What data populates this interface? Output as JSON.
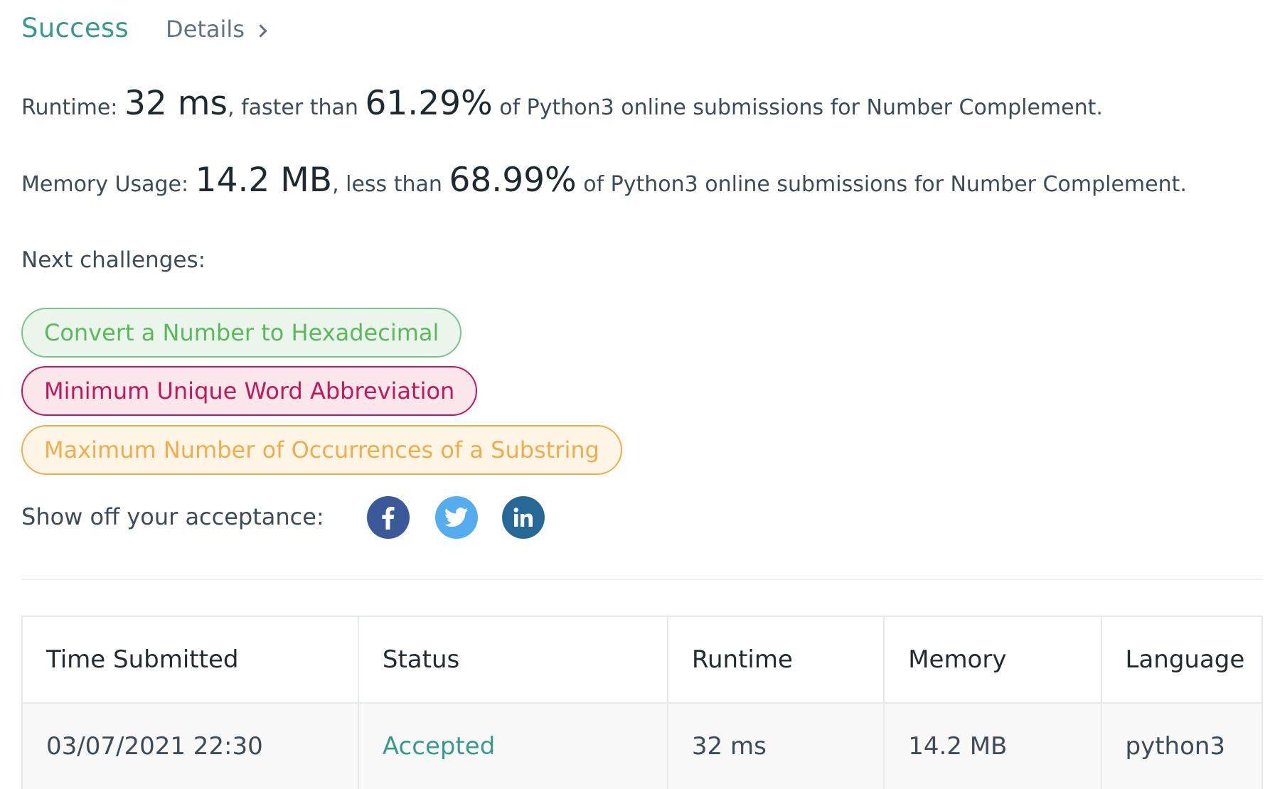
{
  "header": {
    "status": "Success",
    "details_label": "Details"
  },
  "runtime": {
    "prefix": "Runtime:",
    "value": "32 ms",
    "comparison": ", faster than",
    "percent": "61.29%",
    "suffix": "of Python3 online submissions for Number Complement."
  },
  "memory": {
    "prefix": "Memory Usage:",
    "value": "14.2 MB",
    "comparison": ", less than",
    "percent": "68.99%",
    "suffix": "of Python3 online submissions for Number Complement."
  },
  "next_challenges": {
    "label": "Next challenges:",
    "items": [
      {
        "title": "Convert a Number to Hexadecimal",
        "difficulty_color": "#5cb85c"
      },
      {
        "title": "Minimum Unique Word Abbreviation",
        "difficulty_color": "#c2185b"
      },
      {
        "title": "Maximum Number of Occurrences of a Substring",
        "difficulty_color": "#f0ad4e"
      }
    ]
  },
  "share": {
    "label": "Show off your acceptance:",
    "icons": [
      "facebook-icon",
      "twitter-icon",
      "linkedin-icon"
    ]
  },
  "submissions_table": {
    "headers": [
      "Time Submitted",
      "Status",
      "Runtime",
      "Memory",
      "Language"
    ],
    "rows": [
      [
        "03/07/2021 22:30",
        "Accepted",
        "32 ms",
        "14.2 MB",
        "python3"
      ]
    ]
  },
  "colors": {
    "success": "#3a9a8a",
    "facebook": "#3b5998",
    "twitter": "#55acee",
    "linkedin": "#286896"
  }
}
